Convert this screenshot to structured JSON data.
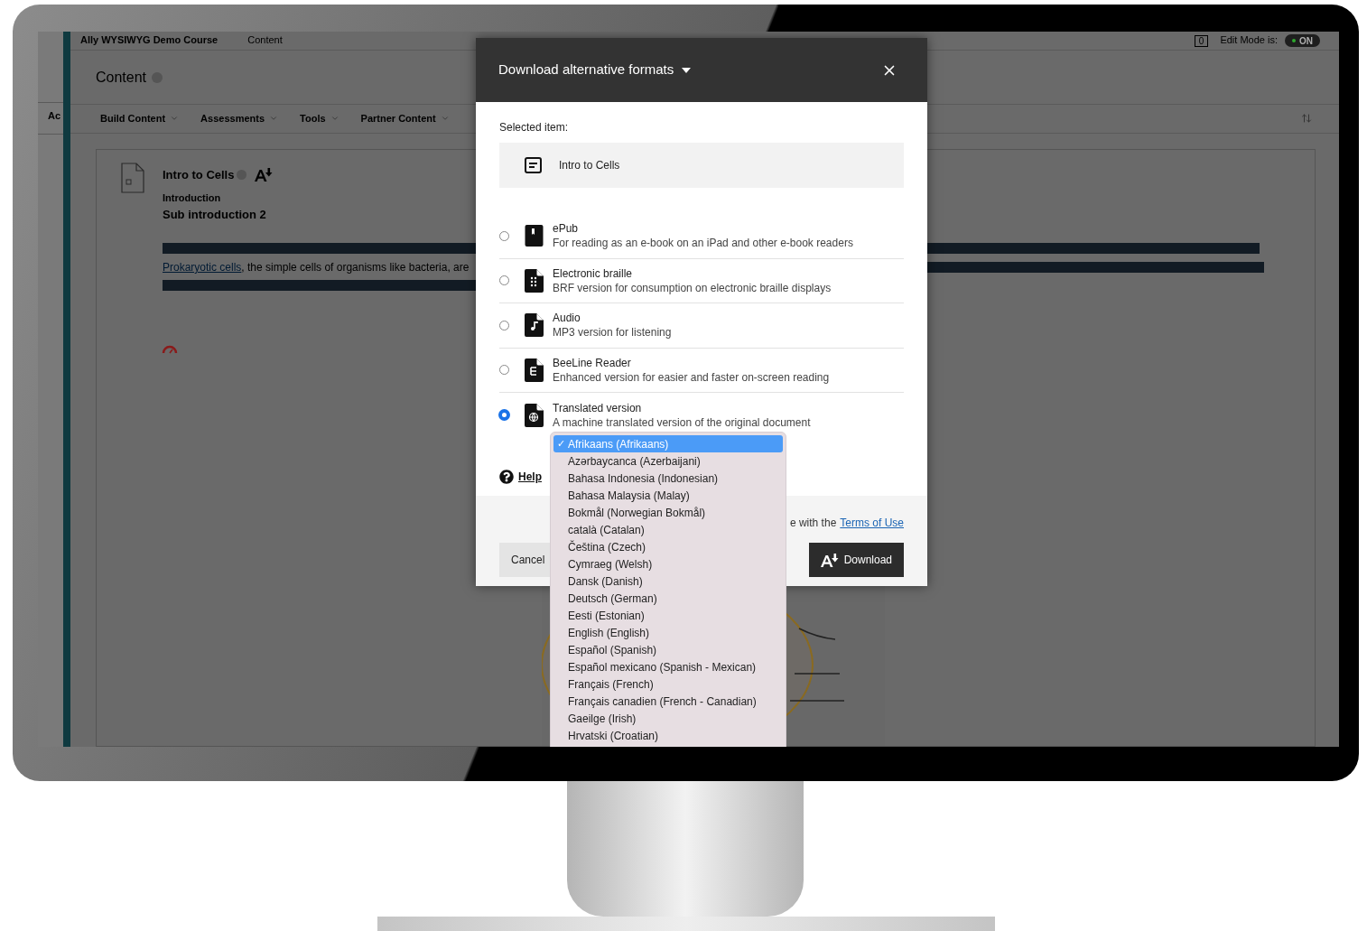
{
  "screen": {
    "course_bar": {
      "course": "Ally WYSIWYG Demo Course",
      "breadcrumb": "Content",
      "notification_count": "0",
      "edit_mode_label": "Edit Mode is:",
      "edit_mode_value": "ON",
      "edit_mode_on": true
    },
    "side_tab": "Ac",
    "page_title": "Content",
    "menu": [
      "Build Content",
      "Assessments",
      "Tools",
      "Partner Content"
    ],
    "content_item": {
      "title": "Intro to Cells",
      "heading": "Introduction",
      "subheading": "Sub introduction 2",
      "paragraph_link": "Prokaryotic cells",
      "paragraph_text": ", the simple cells of organisms like bacteria, are"
    },
    "dialog": {
      "title": "Download alternative formats",
      "selected_label": "Selected item:",
      "selected_item": "Intro to Cells",
      "formats": [
        {
          "kind": "epub",
          "name": "ePub",
          "description": "For reading as an e-book on an iPad and other e-book readers",
          "selected": false
        },
        {
          "kind": "braille",
          "name": "Electronic braille",
          "description": "BRF version for consumption on electronic braille displays",
          "selected": false
        },
        {
          "kind": "audio",
          "name": "Audio",
          "description": "MP3 version for listening",
          "selected": false
        },
        {
          "kind": "beeline",
          "name": "BeeLine Reader",
          "description": "Enhanced version for easier and faster on-screen reading",
          "selected": false
        },
        {
          "kind": "translated",
          "name": "Translated version",
          "description": "A machine translated version of the original document",
          "selected": true
        }
      ],
      "help": "Help",
      "terms_text": "e with the",
      "terms_link": "Terms of Use",
      "cancel": "Cancel",
      "download": "Download"
    },
    "language_menu": {
      "check_mark": "✓",
      "options": [
        {
          "label": "Afrikaans (Afrikaans)",
          "selected": true
        },
        {
          "label": "Azərbaycanca (Azerbaijani)",
          "selected": false
        },
        {
          "label": "Bahasa Indonesia (Indonesian)",
          "selected": false
        },
        {
          "label": "Bahasa Malaysia (Malay)",
          "selected": false
        },
        {
          "label": "Bokmål (Norwegian Bokmål)",
          "selected": false
        },
        {
          "label": "català (Catalan)",
          "selected": false
        },
        {
          "label": "Čeština (Czech)",
          "selected": false
        },
        {
          "label": "Cymraeg (Welsh)",
          "selected": false
        },
        {
          "label": "Dansk (Danish)",
          "selected": false
        },
        {
          "label": "Deutsch (German)",
          "selected": false
        },
        {
          "label": "Eesti (Estonian)",
          "selected": false
        },
        {
          "label": "English (English)",
          "selected": false
        },
        {
          "label": "Español (Spanish)",
          "selected": false
        },
        {
          "label": "Español mexicano (Spanish - Mexican)",
          "selected": false
        },
        {
          "label": "Français (French)",
          "selected": false
        },
        {
          "label": "Français canadien (French - Canadian)",
          "selected": false
        },
        {
          "label": "Gaeilge (Irish)",
          "selected": false
        },
        {
          "label": "Hrvatski (Croatian)",
          "selected": false
        }
      ]
    }
  }
}
